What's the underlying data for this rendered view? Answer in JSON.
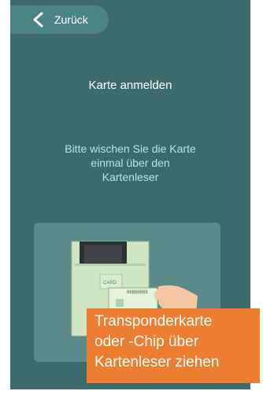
{
  "header": {
    "back_label": "Zurück",
    "back_icon": "chevron-left-icon"
  },
  "main": {
    "title": "Karte anmelden",
    "instruction_lines": [
      "Bitte wischen Sie die Karte",
      "einmal über den",
      "Kartenleser"
    ],
    "illustration": {
      "card_label": "CARD",
      "card_number": "88888888"
    }
  },
  "annotation": {
    "lines": [
      "Transponderkarte",
      "oder -Chip über",
      "Kartenleser ziehen"
    ],
    "color": "#ec7d31"
  },
  "colors": {
    "background": "#3d6a6b",
    "back_button": "#4a8483",
    "panel": "#5c8a8b",
    "instruction_text": "#b6e3de"
  }
}
